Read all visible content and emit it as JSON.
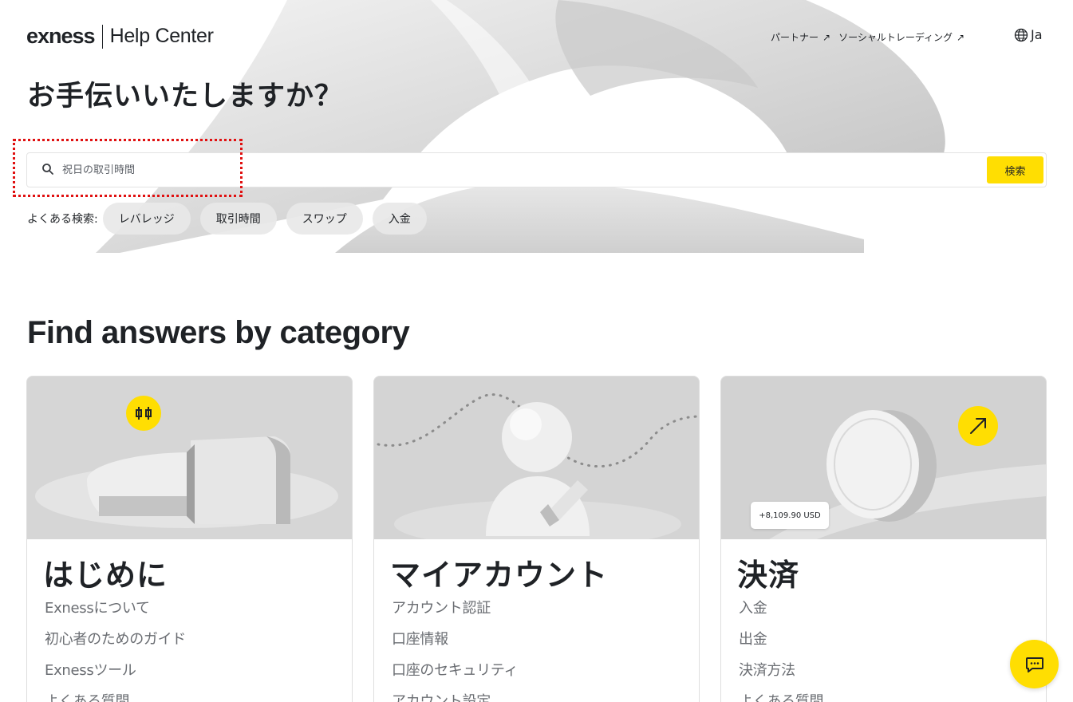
{
  "header": {
    "logo_word": "exness",
    "logo_sub": "Help Center",
    "nav": [
      {
        "label": "パートナー",
        "icon": "arrow-up-right-icon"
      },
      {
        "label": "ソーシャルトレーディング",
        "icon": "arrow-up-right-icon"
      }
    ],
    "language": {
      "label": "Ja",
      "icon": "globe-icon"
    }
  },
  "hero": {
    "title": "お手伝いいたしますか？",
    "search": {
      "placeholder": "祝日の取引時間",
      "value": "",
      "button_label": "検索",
      "icon": "search-icon"
    },
    "popular_label": "よくある検索:",
    "popular_chips": [
      "レバレッジ",
      "取引時間",
      "スワップ",
      "入金"
    ]
  },
  "categories": {
    "title": "Find answers by category",
    "cards": [
      {
        "title": "はじめに",
        "badge_icon": "candlestick-icon",
        "links": [
          "Exnessについて",
          "初心者のためのガイド",
          "Exnessツール",
          "よくある質問"
        ]
      },
      {
        "title": "マイアカウント",
        "links": [
          "アカウント認証",
          "口座情報",
          "口座のセキュリティ",
          "アカウント設定"
        ]
      },
      {
        "title": "決済",
        "badge_icon": "arrow-up-right-icon",
        "amount_badge": "+8,109.90 USD",
        "links": [
          "入金",
          "出金",
          "決済方法",
          "よくある質問"
        ]
      }
    ]
  },
  "chat": {
    "icon": "chat-icon"
  },
  "colors": {
    "accent": "#ffde02",
    "text": "#1f2226",
    "link_gray": "#6a6d72",
    "highlight": "#e01010"
  }
}
